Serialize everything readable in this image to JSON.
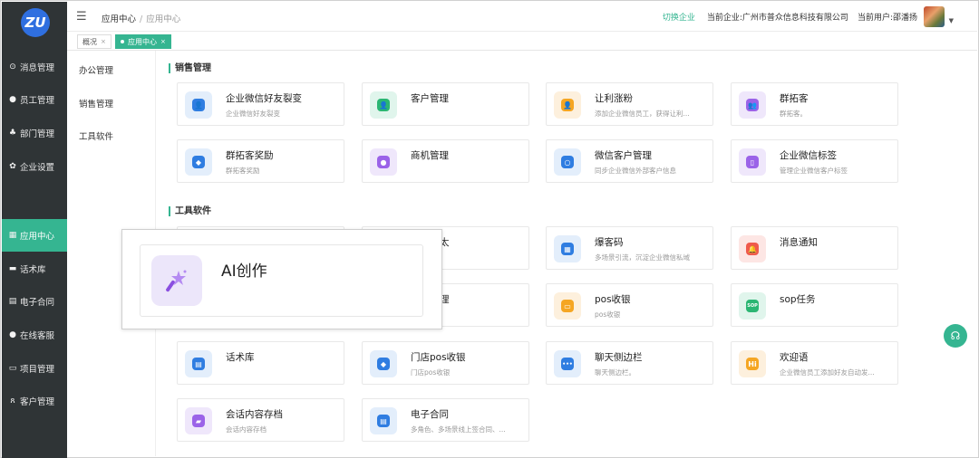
{
  "logo": {
    "text": "ZU"
  },
  "sidebar": {
    "items": [
      {
        "label": "消息管理",
        "icon": "message-icon",
        "glyph": "⊙"
      },
      {
        "label": "员工管理",
        "icon": "user-icon",
        "glyph": "●"
      },
      {
        "label": "部门管理",
        "icon": "org-icon",
        "glyph": "♣"
      },
      {
        "label": "企业设置",
        "icon": "gear-icon",
        "glyph": "✿"
      },
      {
        "label": "应用中心",
        "icon": "apps-icon",
        "glyph": "▦"
      },
      {
        "label": "话术库",
        "icon": "chat-icon",
        "glyph": "▬"
      },
      {
        "label": "电子合同",
        "icon": "contract-icon",
        "glyph": "▤"
      },
      {
        "label": "在线客服",
        "icon": "service-icon",
        "glyph": "●"
      },
      {
        "label": "项目管理",
        "icon": "project-icon",
        "glyph": "▭"
      },
      {
        "label": "客户管理",
        "icon": "customer-icon",
        "glyph": "ጸ"
      }
    ]
  },
  "header": {
    "breadcrumb": [
      "应用中心",
      "/",
      "应用中心"
    ],
    "switch_company": "切换企业",
    "company_label": "当前企业:",
    "company_name": "广州市普众信息科技有限公司",
    "user_label": "当前用户:",
    "user_name": "邵潘扬",
    "menu_glyph": "☰",
    "caret": "▼"
  },
  "tabs": [
    {
      "label": "概况",
      "close": "×"
    },
    {
      "label": "应用中心",
      "close": "×"
    }
  ],
  "submenu": [
    "办公管理",
    "销售管理",
    "工具软件"
  ],
  "sections": {
    "sales": "销售管理",
    "tools": "工具软件"
  },
  "sales_cards": [
    {
      "title": "企业微信好友裂变",
      "desc": "企业微信好友裂变",
      "icon": "user-add-icon",
      "color": "blue",
      "glyph": "👤"
    },
    {
      "title": "客户管理",
      "desc": "",
      "icon": "customer-icon",
      "color": "green",
      "glyph": "👤"
    },
    {
      "title": "让利涨粉",
      "desc": "添加企业微信员工，获得让利...",
      "icon": "fans-icon",
      "color": "orange",
      "glyph": "👤"
    },
    {
      "title": "群拓客",
      "desc": "群拓客。",
      "icon": "group-icon",
      "color": "purple",
      "glyph": "👥"
    },
    {
      "title": "群拓客奖励",
      "desc": "群拓客奖励",
      "icon": "reward-icon",
      "color": "blue",
      "glyph": "◆"
    },
    {
      "title": "商机管理",
      "desc": "",
      "icon": "bulb-icon",
      "color": "purple",
      "glyph": "●"
    },
    {
      "title": "微信客户管理",
      "desc": "同步企业微信外部客户信息",
      "icon": "wechat-icon",
      "color": "blue",
      "glyph": "○"
    },
    {
      "title": "企业微信标签",
      "desc": "管理企业微信客户标签",
      "icon": "tag-icon",
      "color": "purple",
      "glyph": "▯"
    }
  ],
  "tool_cards": [
    {
      "title": "",
      "desc": "",
      "icon": "hidden-icon",
      "color": "blue",
      "glyph": ""
    },
    {
      "title": "太",
      "desc": "",
      "icon": "hidden-icon",
      "color": "blue",
      "glyph": ""
    },
    {
      "title": "爆客码",
      "desc": "多场景引流，沉淀企业微信私域",
      "icon": "qrcode-icon",
      "color": "blue",
      "glyph": "▦"
    },
    {
      "title": "消息通知",
      "desc": "",
      "icon": "bell-icon",
      "color": "red",
      "glyph": "🔔"
    },
    {
      "title": "",
      "desc": "",
      "icon": "hidden-icon",
      "color": "blue",
      "glyph": ""
    },
    {
      "title": "理",
      "desc": "",
      "icon": "hidden-icon",
      "color": "blue",
      "glyph": ""
    },
    {
      "title": "pos收银",
      "desc": "pos收银",
      "icon": "pos-icon",
      "color": "orange",
      "glyph": "▭"
    },
    {
      "title": "sop任务",
      "desc": "",
      "icon": "sop-icon",
      "color": "green",
      "glyph": "SOP"
    },
    {
      "title": "话术库",
      "desc": "",
      "icon": "script-icon",
      "color": "blue",
      "glyph": "▤"
    },
    {
      "title": "门店pos收银",
      "desc": "门店pos收银",
      "icon": "store-pos-icon",
      "color": "blue",
      "glyph": "◆"
    },
    {
      "title": "聊天侧边栏",
      "desc": "聊天侧边栏。",
      "icon": "sidebar-chat-icon",
      "color": "blue",
      "glyph": "•••"
    },
    {
      "title": "欢迎语",
      "desc": "企业微信员工添加好友自动发...",
      "icon": "hi-icon",
      "color": "orange",
      "glyph": "Hi"
    },
    {
      "title": "会话内容存档",
      "desc": "会话内容存档",
      "icon": "archive-icon",
      "color": "purple",
      "glyph": "▰"
    },
    {
      "title": "电子合同",
      "desc": "多角色、多场景线上签合同、...",
      "icon": "contract-icon",
      "color": "blue",
      "glyph": "▤"
    }
  ],
  "popup": {
    "title": "AI创作",
    "icon": "magic-wand-icon",
    "glyph": "✦"
  },
  "float_button": {
    "icon": "headset-icon",
    "glyph": "☊"
  }
}
